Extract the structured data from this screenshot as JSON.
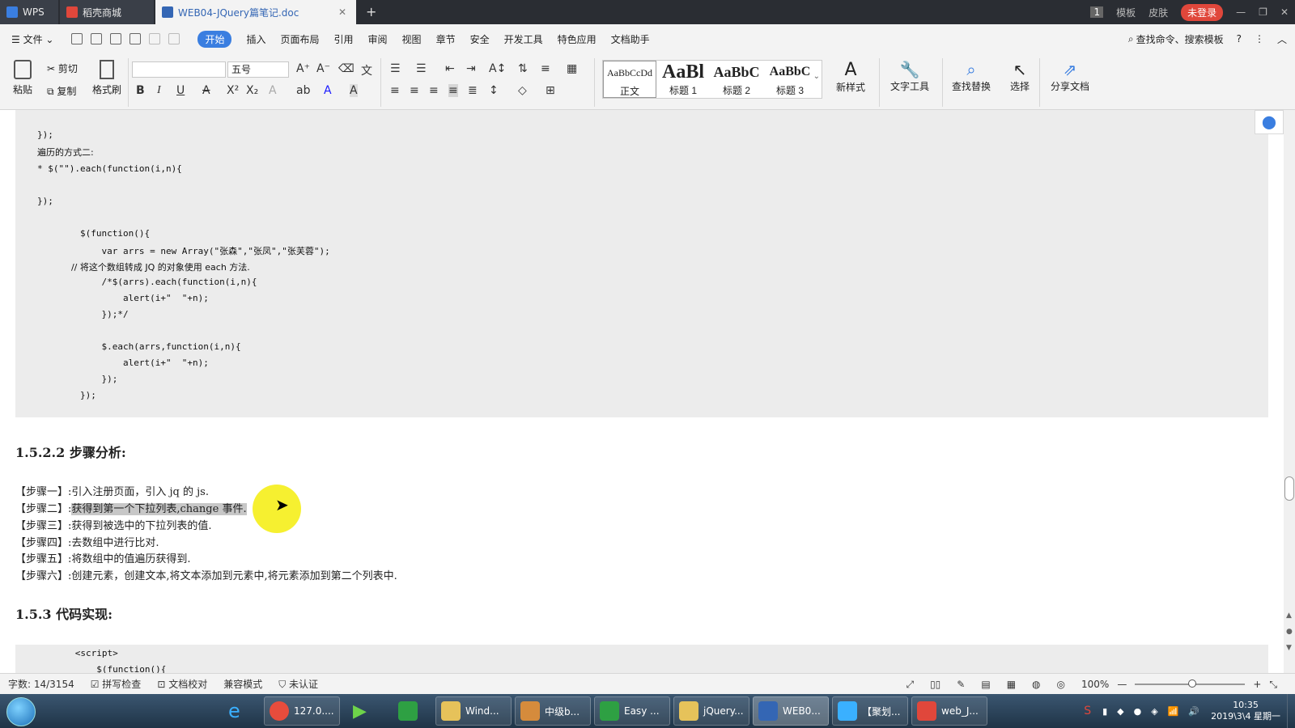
{
  "titlebar": {
    "tabs": [
      {
        "label": "WPS"
      },
      {
        "label": "稻壳商城"
      },
      {
        "label": "WEB04-JQuery篇笔记.doc"
      }
    ],
    "badge": "1",
    "template_label": "模板",
    "skin_label": "皮肤",
    "login_label": "未登录"
  },
  "menubar": {
    "file_label": "文件",
    "items": [
      "开始",
      "插入",
      "页面布局",
      "引用",
      "审阅",
      "视图",
      "章节",
      "安全",
      "开发工具",
      "特色应用",
      "文档助手"
    ],
    "search_label": "查找命令、搜索模板",
    "help_label": "?"
  },
  "ribbon": {
    "paste": "粘贴",
    "cut": "剪切",
    "copy": "复制",
    "format_painter": "格式刷",
    "font_name": "",
    "font_size": "五号",
    "styles": [
      {
        "preview": "AaBbCcDd",
        "label": "正文"
      },
      {
        "preview": "AaBl",
        "label": "标题 1"
      },
      {
        "preview": "AaBbC",
        "label": "标题 2"
      },
      {
        "preview": "AaBbC",
        "label": "标题 3"
      }
    ],
    "new_style": "新样式",
    "text_tools": "文字工具",
    "find_replace": "查找替换",
    "select": "选择",
    "share_doc": "分享文档"
  },
  "document": {
    "code1": [
      "});",
      "遍历的方式二:",
      "* $(\"\").each(function(i,n){",
      "",
      "});",
      "",
      "",
      "        $(function(){",
      "            var arrs = new Array(\"张森\",\"张凤\",\"张芙蓉\");",
      "            // 将这个数组转成 JQ 的对象使用 each 方法.",
      "            /*$(arrs).each(function(i,n){",
      "                alert(i+\"  \"+n);",
      "            });*/",
      "",
      "            $.each(arrs,function(i,n){",
      "                alert(i+\"  \"+n);",
      "            });",
      "        });"
    ],
    "heading1": "1.5.2.2 步骤分析:",
    "steps": [
      {
        "prefix": "【步骤一】:",
        "text": "引入注册页面，引入 jq 的 js."
      },
      {
        "prefix": "【步骤二】:",
        "text": "获得到第一个下拉列表,change 事件."
      },
      {
        "prefix": "【步骤三】:",
        "text": "获得到被选中的下拉列表的值."
      },
      {
        "prefix": "【步骤四】:",
        "text": "去数组中进行比对."
      },
      {
        "prefix": "【步骤五】:",
        "text": "将数组中的值遍历获得到."
      },
      {
        "prefix": "【步骤六】:",
        "text": "创建元素，创建文本,将文本添加到元素中,将元素添加到第二个列表中."
      }
    ],
    "heading2": "1.5.3  代码实现:",
    "code2": [
      "      <script>",
      "          $(function(){"
    ]
  },
  "statusbar": {
    "word_count": "字数: 14/3154",
    "spell_check": "拼写检查",
    "doc_proof": "文档校对",
    "compat_mode": "兼容模式",
    "uncertified": "未认证",
    "zoom": "100%"
  },
  "taskbar": {
    "tasks": [
      "127.0....",
      "Wind...",
      "中级b...",
      "Easy ...",
      "jQuery...",
      "WEB0...",
      "【聚划...",
      "web_J..."
    ],
    "time": "10:35",
    "date": "2019\\3\\4 星期一"
  },
  "colors": {
    "accent": "#3a7ee0",
    "login": "#e0473b",
    "code_bg": "#ececec",
    "highlight": "#f5ee1a"
  }
}
